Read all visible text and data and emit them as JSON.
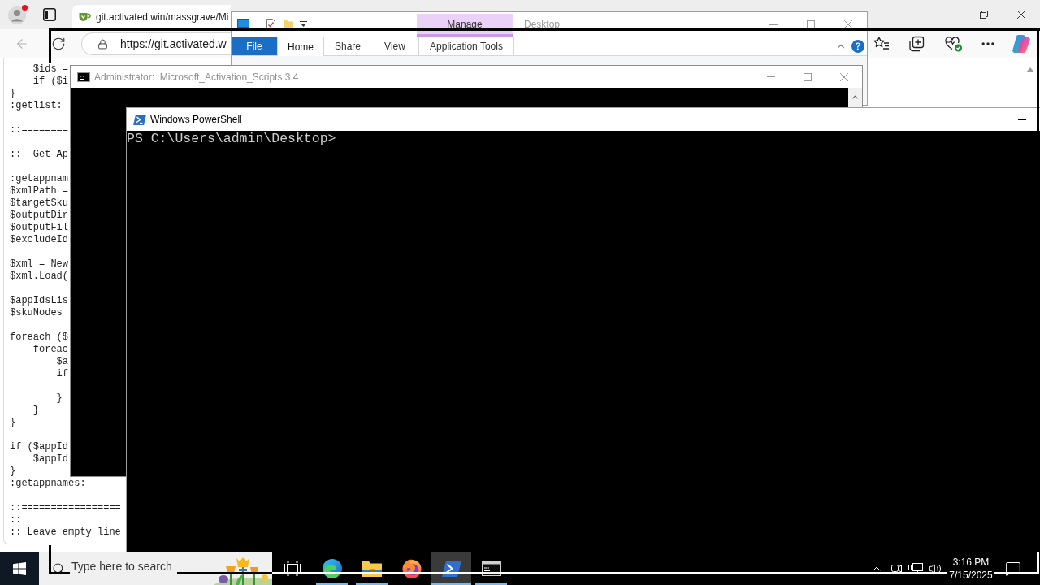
{
  "browser": {
    "tab": {
      "title": "git.activated.win/massgrave/Mi"
    },
    "address": "https://git.activated.w",
    "code_blocks": [
      [
        "    $ids =",
        "    if ($i",
        "}",
        ":getlist:"
      ],
      [
        "::========"
      ],
      [
        "::  Get Ap"
      ],
      [
        ":getappnam",
        "$xmlPath =",
        "$targetSku",
        "$outputDir",
        "$outputFil",
        "$excludeId"
      ],
      [
        "$xml = New",
        "$xml.Load("
      ],
      [
        "$appIdsLis",
        "$skuNodes"
      ],
      [
        "foreach ($",
        "    foreac",
        "        $a",
        "        if"
      ],
      [
        "        }",
        "    }",
        "}"
      ],
      [
        "if ($appId",
        "    $appId",
        "}",
        ":getappnames:"
      ],
      [
        "::=================",
        "::",
        ":: Leave empty line"
      ]
    ]
  },
  "explorer": {
    "title": "Desktop",
    "active": false,
    "context_group": "Manage",
    "tabs": [
      {
        "label": "File",
        "kind": "file",
        "selected": false
      },
      {
        "label": "Home",
        "kind": "standard",
        "selected": true
      },
      {
        "label": "Share",
        "kind": "standard",
        "selected": false
      },
      {
        "label": "View",
        "kind": "standard",
        "selected": false
      },
      {
        "label": "Application Tools",
        "kind": "contextual",
        "selected": false
      }
    ]
  },
  "cmd": {
    "title": "Administrator:  Microsoft_Activation_Scripts 3.4",
    "active": false
  },
  "powershell": {
    "title": "Windows PowerShell",
    "active": true,
    "lines": [
      "PS C:\\Users\\admin\\Desktop>"
    ]
  },
  "taskbar": {
    "search": {
      "placeholder": "Type here to search"
    },
    "apps": [
      {
        "kind": "taskview",
        "selected": false,
        "running": false
      },
      {
        "kind": "edge",
        "selected": false,
        "running": true
      },
      {
        "kind": "explorer",
        "selected": false,
        "running": true
      },
      {
        "kind": "firefox",
        "selected": false,
        "running": false
      },
      {
        "kind": "powershell",
        "selected": true,
        "running": true
      },
      {
        "kind": "cmd",
        "selected": false,
        "running": true
      }
    ],
    "time": "3:16 PM",
    "date": "7/15/2025"
  }
}
